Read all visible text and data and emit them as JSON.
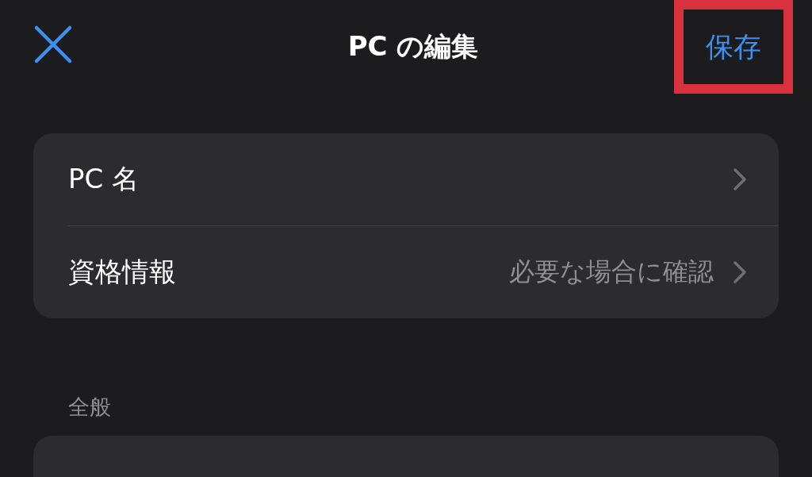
{
  "header": {
    "title": "PC の編集",
    "save_button": {
      "label": "保存",
      "highlighted": true
    }
  },
  "settings": [
    {
      "label": "PC 名"
    },
    {
      "label": "資格情報",
      "value": "必要な場合に確認"
    }
  ],
  "sections": [
    {
      "title": "全般"
    }
  ]
}
